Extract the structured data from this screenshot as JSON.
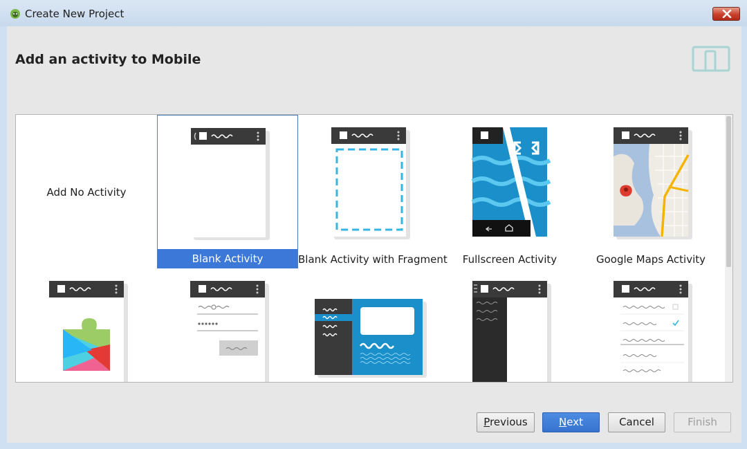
{
  "window": {
    "title": "Create New Project"
  },
  "header": {
    "title": "Add an activity to Mobile"
  },
  "gallery": {
    "items": [
      {
        "label": "Add No Activity"
      },
      {
        "label": "Blank Activity",
        "selected": true
      },
      {
        "label": "Blank Activity with Fragment"
      },
      {
        "label": "Fullscreen Activity"
      },
      {
        "label": "Google Maps Activity"
      }
    ],
    "row2_preview": [
      "Google Play Services Activity",
      "Login Activity",
      "Master/Detail Flow",
      "Navigation Drawer Activity",
      "Settings Activity"
    ]
  },
  "buttons": {
    "previous_mnemonic": "P",
    "previous_rest": "revious",
    "next_mnemonic": "N",
    "next_rest": "ext",
    "cancel": "Cancel",
    "finish": "Finish"
  },
  "colors": {
    "accent": "#3c78d8",
    "selection": "#3c78d8",
    "header_bg": "#e7e7e7"
  }
}
